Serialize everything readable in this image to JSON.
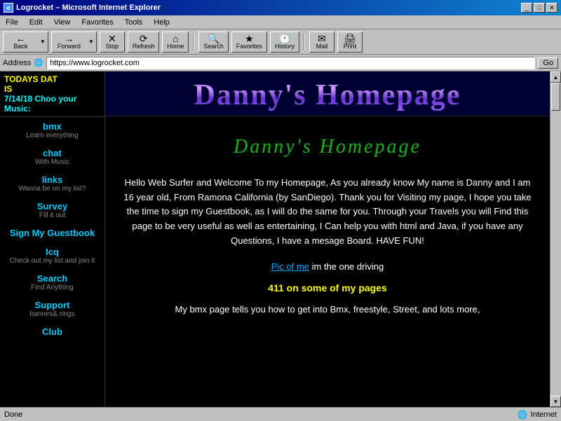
{
  "window": {
    "title": "Logrocket – Microsoft Internet Explorer",
    "icon": "ie"
  },
  "menu": {
    "items": [
      "File",
      "Edit",
      "View",
      "Favorites",
      "Tools",
      "Help"
    ]
  },
  "toolbar": {
    "back_label": "Back",
    "forward_label": "Forward",
    "stop_label": "Stop",
    "refresh_label": "Refresh",
    "home_label": "Home",
    "search_label": "Search",
    "favorites_label": "Favorites",
    "history_label": "History",
    "mail_label": "Mail",
    "print_label": "Print"
  },
  "address": {
    "label": "Address",
    "url": "https://www.logrocket.com",
    "go": "Go"
  },
  "sidebar": {
    "today_label": "TODAYS DAT",
    "today_is": "IS",
    "today_date": "7/14/18",
    "today_extra": "Choo your Music:",
    "items": [
      {
        "link": "bmx",
        "sub": "Learn everything"
      },
      {
        "link": "chat",
        "sub": "With Music"
      },
      {
        "link": "links",
        "sub": "Wanna be on my list?"
      },
      {
        "link": "Survey",
        "sub": "Fill it out"
      },
      {
        "link": "Sign My Guestbook",
        "sub": ""
      },
      {
        "link": "Icq",
        "sub": "Check out my list and join it"
      },
      {
        "link": "Search",
        "sub": "Find Anything"
      },
      {
        "link": "Support",
        "sub": "bannes& rings"
      },
      {
        "link": "Club",
        "sub": ""
      }
    ]
  },
  "main": {
    "header_title": "Danny's Homepage",
    "subtitle": "Danny's Homepage",
    "welcome_text": "Hello Web Surfer and Welcome To my Homepage, As you already know My name is Danny and I am 16 year old, From Ramona California (by SanDiego). Thank you for Visiting my page, I hope you take the time to sign my Guestbook, as I will do the same for you. Through your Travels you will Find this page to be very useful as well as entertaining, I Can help you with html and Java, if you have any Questions, I have a mesage Board. HAVE FUN!",
    "pic_link_text": "Pic of me",
    "pic_rest": " im the one driving",
    "pages_411": "411 on some of my pages",
    "bmx_text": "My bmx page tells you how to get into Bmx, freestyle, Street, and lots more,"
  },
  "status": {
    "left": "Done",
    "zone": "Internet"
  }
}
